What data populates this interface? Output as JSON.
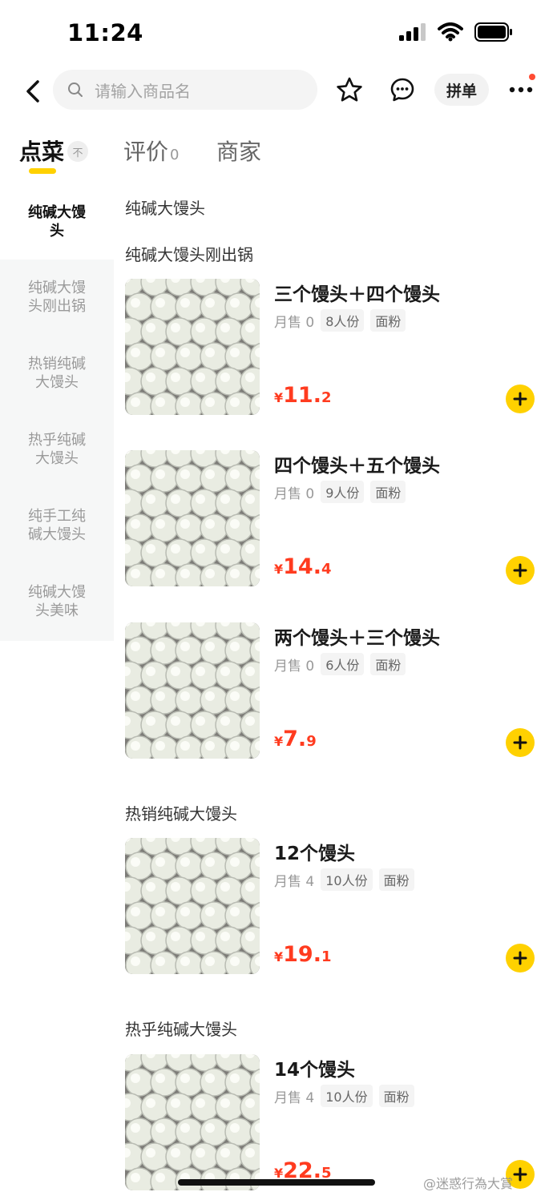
{
  "status_bar": {
    "time": "11:24"
  },
  "search": {
    "placeholder": "请输入商品名"
  },
  "nav": {
    "group_buy_label": "拼单"
  },
  "tabs": [
    {
      "label": "点菜"
    },
    {
      "label": "评价",
      "count": "0"
    },
    {
      "label": "商家"
    }
  ],
  "pin_top_label": "不",
  "sidebar": {
    "items": [
      {
        "label": "纯碱大馒头"
      },
      {
        "label": "纯碱大馒头刚出锅"
      },
      {
        "label": "热销纯碱大馒头"
      },
      {
        "label": "热乎纯碱大馒头"
      },
      {
        "label": "纯手工纯碱大馒头"
      },
      {
        "label": "纯碱大馒头美味"
      }
    ]
  },
  "sections": [
    {
      "title": "纯碱大馒头"
    },
    {
      "title": "纯碱大馒头刚出锅"
    },
    {
      "title": "热销纯碱大馒头"
    },
    {
      "title": "热乎纯碱大馒头"
    }
  ],
  "products": [
    {
      "name": "三个馒头＋四个馒头",
      "sold": "月售 0",
      "serves": "8人份",
      "tag": "面粉",
      "currency": "¥",
      "price_int": "11.",
      "price_dec": "2"
    },
    {
      "name": "四个馒头＋五个馒头",
      "sold": "月售 0",
      "serves": "9人份",
      "tag": "面粉",
      "currency": "¥",
      "price_int": "14.",
      "price_dec": "4"
    },
    {
      "name": "两个馒头＋三个馒头",
      "sold": "月售 0",
      "serves": "6人份",
      "tag": "面粉",
      "currency": "¥",
      "price_int": "7.",
      "price_dec": "9"
    },
    {
      "name": "12个馒头",
      "sold": "月售 4",
      "serves": "10人份",
      "tag": "面粉",
      "currency": "¥",
      "price_int": "19.",
      "price_dec": "1"
    },
    {
      "name": "14个馒头",
      "sold": "月售 4",
      "serves": "10人份",
      "tag": "面粉",
      "currency": "¥",
      "price_int": "22.",
      "price_dec": "5"
    }
  ],
  "watermark": "@迷惑行為大賞",
  "colors": {
    "accent": "#ffd100",
    "price": "#ff3b1f",
    "badge": "#ff4b33"
  },
  "icons": [
    "signal-icon",
    "wifi-icon",
    "battery-icon",
    "back-icon",
    "search-icon",
    "star-icon",
    "chat-icon",
    "more-icon",
    "plus-icon"
  ]
}
